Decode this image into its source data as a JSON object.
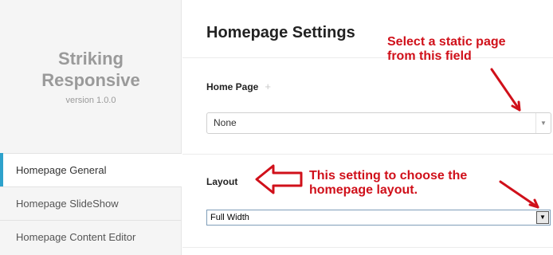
{
  "sidebar": {
    "brand_line1": "Striking",
    "brand_line2": "Responsive",
    "version": "version 1.0.0",
    "items": [
      {
        "label": "Homepage General",
        "active": true
      },
      {
        "label": "Homepage SlideShow",
        "active": false
      },
      {
        "label": "Homepage Content Editor",
        "active": false
      }
    ]
  },
  "main": {
    "title": "Homepage Settings",
    "home_page": {
      "label": "Home Page",
      "plus_symbol": "+",
      "selected": "None",
      "arrow": "▼"
    },
    "layout": {
      "label": "Layout",
      "selected": "Full Width",
      "arrow": "▼"
    }
  },
  "annotations": {
    "note1_line1": "Select a static page",
    "note1_line2": "from this field",
    "note2_line1": "This setting to choose the",
    "note2_line2": "homepage layout.",
    "color": "#d0101a"
  },
  "colors": {
    "active_accent": "#2ea2cc",
    "sidebar_bg": "#f5f5f5"
  }
}
